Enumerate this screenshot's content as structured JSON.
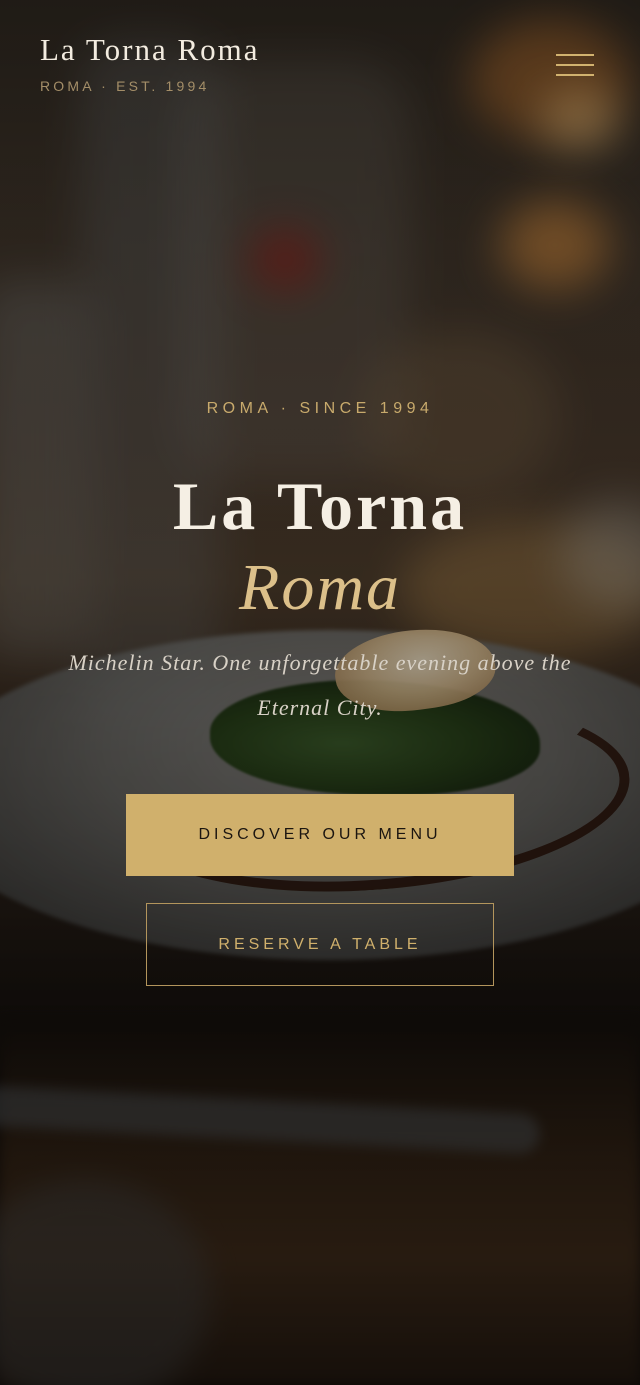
{
  "header": {
    "brand_name": "La Torna Roma",
    "brand_sub": "ROMA · EST. 1994",
    "menu_icon": "hamburger-menu-icon"
  },
  "hero": {
    "eyebrow": "ROMA · SINCE 1994",
    "title_line1": "La Torna",
    "title_line2": "Roma",
    "tagline": "Michelin Star. One unforgettable evening above the Eternal City.",
    "primary_cta": "DISCOVER OUR MENU",
    "secondary_cta": "RESERVE A TABLE"
  },
  "colors": {
    "accent_gold": "#d0b06c",
    "text_light": "#f5efe4",
    "muted_gold": "#a48e68"
  }
}
